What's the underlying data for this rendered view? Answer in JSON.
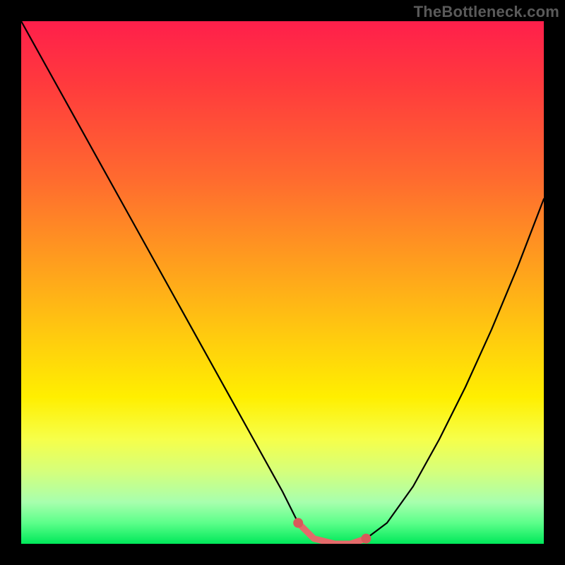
{
  "watermark": "TheBottleneck.com",
  "chart_data": {
    "type": "line",
    "title": "",
    "xlabel": "",
    "ylabel": "",
    "xlim": [
      0,
      100
    ],
    "ylim": [
      0,
      100
    ],
    "grid": false,
    "legend": false,
    "series": [
      {
        "name": "bottleneck-curve",
        "color": "#000000",
        "x": [
          0,
          5,
          10,
          15,
          20,
          25,
          30,
          35,
          40,
          45,
          50,
          53,
          56,
          60,
          63,
          66,
          70,
          75,
          80,
          85,
          90,
          95,
          100
        ],
        "y": [
          100,
          91,
          82,
          73,
          64,
          55,
          46,
          37,
          28,
          19,
          10,
          4,
          1,
          0,
          0,
          1,
          4,
          11,
          20,
          30,
          41,
          53,
          66
        ]
      },
      {
        "name": "highlight-segment",
        "color": "#e46a6a",
        "x": [
          53,
          56,
          60,
          63,
          66
        ],
        "y": [
          4,
          1,
          0,
          0,
          1
        ]
      }
    ],
    "annotations": []
  },
  "colors": {
    "curve": "#000000",
    "highlight": "#e46a6a",
    "highlight_dot": "#d85a5a",
    "frame": "#000000"
  }
}
